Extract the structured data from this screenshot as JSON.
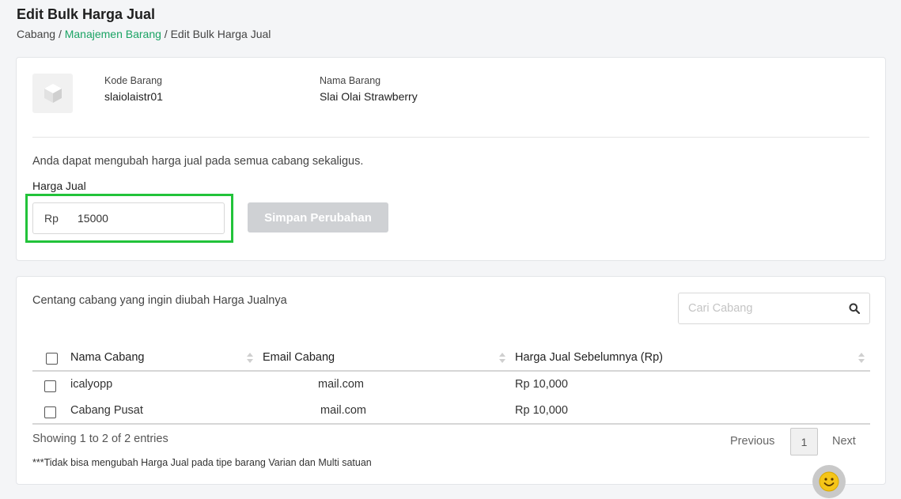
{
  "header": {
    "title": "Edit Bulk Harga Jual",
    "breadcrumb": [
      {
        "label": "Cabang"
      },
      {
        "sep": "/"
      },
      {
        "label": "Manajemen Barang"
      },
      {
        "sep2": "/"
      },
      {
        "label": "Edit Bulk Harga Jual"
      }
    ]
  },
  "product": {
    "code_label": "Kode Barang",
    "code_value": "slaiolaistr01",
    "name_label": "Nama Barang",
    "name_value": "Slai Olai Strawberry",
    "thumbnail_icon": "box-icon"
  },
  "price_form": {
    "hint": "Anda dapat mengubah harga jual pada semua cabang sekaligus.",
    "label": "Harga Jual",
    "prefix": "Rp",
    "value": "15000",
    "save_label": "Simpan Perubahan",
    "highlight_color": "#22c33a"
  },
  "branches": {
    "hint": "Centang cabang yang ingin diubah Harga Jualnya",
    "search_placeholder": "Cari Cabang",
    "columns": [
      "Nama Cabang",
      "Email Cabang",
      "Harga Jual Sebelumnya (Rp)"
    ],
    "rows": [
      {
        "name": "icalyopp",
        "email": "mail.com",
        "price": "Rp 10,000"
      },
      {
        "name": "Cabang Pusat",
        "email": "mail.com",
        "price": "Rp 10,000"
      }
    ],
    "showing": "Showing 1 to 2 of 2 entries",
    "note": "***Tidak bisa mengubah Harga Jual pada tipe barang Varian dan Multi satuan",
    "pagination": {
      "prev": "Previous",
      "current": "1",
      "next": "Next"
    }
  },
  "colors": {
    "accent": "#1aa364",
    "disabled_button": "#cfd1d4"
  }
}
